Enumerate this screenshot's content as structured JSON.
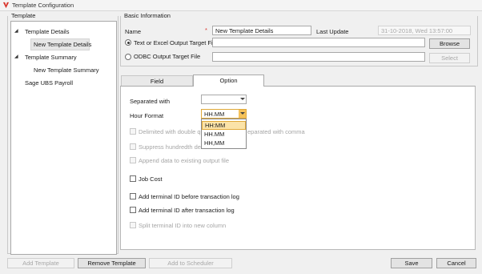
{
  "window": {
    "title": "Template Configuration",
    "icon": "app-logo-icon"
  },
  "template_group": {
    "label": "Template",
    "tree": [
      {
        "label": "Template Details",
        "expanded": true,
        "children": [
          "New Template Details"
        ]
      },
      {
        "label": "Template Summary",
        "expanded": true,
        "children": [
          "New Template Summary"
        ]
      },
      {
        "label": "Sage UBS Payroll"
      }
    ]
  },
  "basic_info": {
    "label": "Basic Information",
    "name_label": "Name",
    "required_mark": "*",
    "name_value": "New Template Details",
    "last_update_label": "Last Update",
    "last_update_value": "31-10-2018, Wed 13:57:00",
    "text_excel_label": "Text or Excel Output Target File",
    "text_excel_value": "",
    "browse_label": "Browse",
    "odbc_label": "ODBC Output Target File",
    "odbc_value": "",
    "select_label": "Select",
    "selected_output": "text_excel"
  },
  "tabs": [
    {
      "label": "Field",
      "active": false
    },
    {
      "label": "Option",
      "active": true
    }
  ],
  "options": {
    "separated_with_label": "Separated with",
    "separated_with_value": "",
    "hour_format_label": "Hour Format",
    "hour_format_value": "HH.MM",
    "hour_format_options": [
      "HH:MM",
      "HH.MM",
      "HH,MM"
    ],
    "hour_format_highlighted": 0,
    "checkboxes": [
      {
        "label": "Delimited with double quotes and separated with comma",
        "visible_parts": [
          "Delimited with double qu",
          "eparated with comma"
        ],
        "checked": false,
        "enabled": false
      },
      {
        "label": "Suppress hundredth decimal",
        "visible_parts": [
          "Suppress hundredth decin"
        ],
        "checked": false,
        "enabled": false
      },
      {
        "label": "Append data to existing output file",
        "checked": false,
        "enabled": false
      },
      {
        "label": "Job Cost",
        "checked": false,
        "enabled": true
      },
      {
        "label": "Add terminal ID before transaction log",
        "checked": false,
        "enabled": true
      },
      {
        "label": "Add terminal ID after transaction log",
        "checked": false,
        "enabled": true
      },
      {
        "label": "Split terminal ID into new column",
        "checked": false,
        "enabled": false
      }
    ]
  },
  "footer": {
    "add_template": "Add Template",
    "remove_template": "Remove Template",
    "add_to_scheduler": "Add to Scheduler",
    "save": "Save",
    "cancel": "Cancel"
  },
  "colors": {
    "dropdown_highlight": "#fbe3a8",
    "dropdown_arrow_bg": "#f5c25a",
    "required": "#d9342b"
  }
}
